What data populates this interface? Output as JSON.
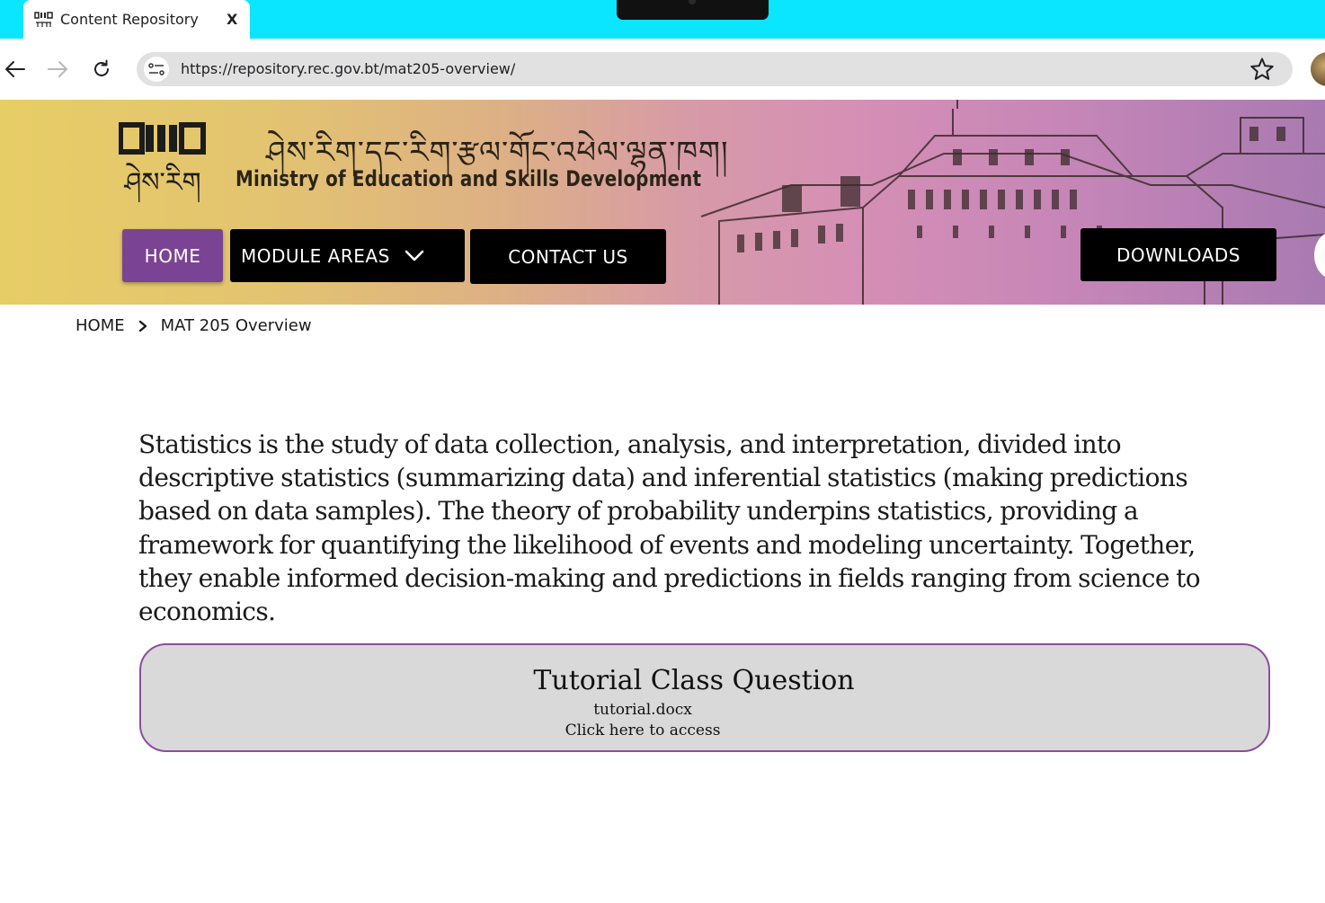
{
  "browser": {
    "tab": {
      "title": "Content Repository",
      "close_label": "X"
    },
    "url": "https://repository.rec.gov.bt/mat205-overview/"
  },
  "header": {
    "logo_dzongkha": "ཤེས་རིག",
    "dzongkha_title": "ཤེས་རིག་དང་རིག་རྩལ་གོང་འཕེལ་ལྷན་ཁག།",
    "ministry_name": "Ministry of Education and Skills Development",
    "nav": {
      "home": "HOME",
      "module_areas": "MODULE AREAS",
      "contact_us": "CONTACT US",
      "downloads": "DOWNLOADS"
    },
    "colors": {
      "home_button": "#7b4394",
      "nav_button": "#000000"
    }
  },
  "breadcrumb": {
    "home": "HOME",
    "current": "MAT 205 Overview"
  },
  "main": {
    "intro": "Statistics is the study of data collection, analysis, and interpretation, divided into descriptive statistics (summarizing data) and inferential statistics (making predictions based on data samples). The theory of probability underpins statistics, providing a framework for quantifying the likelihood of events and modeling uncertainty. Together, they enable informed decision-making and predictions in fields ranging from science to economics.",
    "resource": {
      "title": "Tutorial Class Question",
      "filename": "tutorial.docx",
      "access_text": "Click here to access",
      "border_color": "#8b4e9e"
    }
  },
  "icons": [
    "back-arrow-icon",
    "forward-arrow-icon",
    "reload-icon",
    "site-info-icon",
    "bookmark-star-icon",
    "chevron-down-icon",
    "chevron-right-icon"
  ]
}
